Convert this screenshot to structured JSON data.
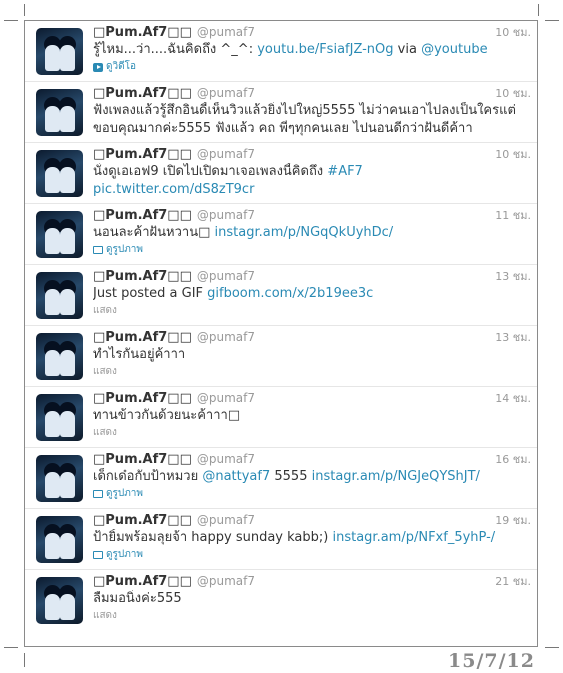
{
  "tweets": [
    {
      "name": "□Pum.Af7□□",
      "handle": "@pumaf7",
      "time": "10 ชม.",
      "lines": [
        [
          {
            "t": "รู้ไหม...ว่า....ฉันคิดถึง ^_^: "
          },
          {
            "t": "youtu.be/FsiafJZ-nOg",
            "link": true
          },
          {
            "t": " via "
          },
          {
            "t": "@youtube",
            "link": true
          }
        ]
      ],
      "meta": {
        "type": "video",
        "label": "ดูวิดีโอ"
      }
    },
    {
      "name": "□Pum.Af7□□",
      "handle": "@pumaf7",
      "time": "10 ชม.",
      "lines": [
        [
          {
            "t": "ฟังเพลงแล้วรู้สึกอินดี้เห็นวิวแล้วยิ่งไปใหญ่5555 ไม่ว่าคนเอาไปลงเป็นใครแต่"
          }
        ],
        [
          {
            "t": "ขอบคุณมากค่ะ5555 ฟังแล้ว คถ พี่ๆทุกคนเลย ไปนอนดีกว่าฝันดีค้าา"
          }
        ]
      ],
      "meta": null
    },
    {
      "name": "□Pum.Af7□□",
      "handle": "@pumaf7",
      "time": "10 ชม.",
      "lines": [
        [
          {
            "t": "นั่งดูเอเอฟ9 เปิดไปเปิดมาเจอเพลงนี้คิดถึง "
          },
          {
            "t": "#AF7",
            "link": true
          }
        ],
        [
          {
            "t": "pic.twitter.com/dS8zT9cr",
            "link": true
          }
        ]
      ],
      "meta": null
    },
    {
      "name": "□Pum.Af7□□",
      "handle": "@pumaf7",
      "time": "11 ชม.",
      "lines": [
        [
          {
            "t": "นอนละค้าฝันหวาน□ "
          },
          {
            "t": "instagr.am/p/NGqQkUyhDc/",
            "link": true
          }
        ]
      ],
      "meta": {
        "type": "photo",
        "label": "ดูรูปภาพ"
      }
    },
    {
      "name": "□Pum.Af7□□",
      "handle": "@pumaf7",
      "time": "13 ชม.",
      "lines": [
        [
          {
            "t": "Just posted a GIF "
          },
          {
            "t": "gifboom.com/x/2b19ee3c",
            "link": true
          }
        ]
      ],
      "meta": {
        "type": "plain",
        "label": "แสดง"
      }
    },
    {
      "name": "□Pum.Af7□□",
      "handle": "@pumaf7",
      "time": "13 ชม.",
      "lines": [
        [
          {
            "t": "ทำไรกันอยู่ค้าาา"
          }
        ]
      ],
      "meta": {
        "type": "plain",
        "label": "แสดง"
      }
    },
    {
      "name": "□Pum.Af7□□",
      "handle": "@pumaf7",
      "time": "14 ชม.",
      "lines": [
        [
          {
            "t": "ทานข้าวกันด้วยนะค้าาา□"
          }
        ]
      ],
      "meta": {
        "type": "plain",
        "label": "แสดง"
      }
    },
    {
      "name": "□Pum.Af7□□",
      "handle": "@pumaf7",
      "time": "16 ชม.",
      "lines": [
        [
          {
            "t": "เด็กเด๋อกับป้าหมวย "
          },
          {
            "t": "@nattyaf7",
            "link": true
          },
          {
            "t": " 5555 "
          },
          {
            "t": "instagr.am/p/NGJeQYShJT/",
            "link": true
          }
        ]
      ],
      "meta": {
        "type": "photo",
        "label": "ดูรูปภาพ"
      }
    },
    {
      "name": "□Pum.Af7□□",
      "handle": "@pumaf7",
      "time": "19 ชม.",
      "lines": [
        [
          {
            "t": "ป้ายิ้มพร้อมลุยจ้า happy sunday kabb;) "
          },
          {
            "t": "instagr.am/p/NFxf_5yhP-/",
            "link": true
          }
        ]
      ],
      "meta": {
        "type": "photo",
        "label": "ดูรูปภาพ"
      }
    },
    {
      "name": "□Pum.Af7□□",
      "handle": "@pumaf7",
      "time": "21 ชม.",
      "lines": [
        [
          {
            "t": "ลืมมอนิ่งค่ะ555"
          }
        ]
      ],
      "meta": {
        "type": "plain",
        "label": "แสดง"
      }
    }
  ],
  "date_stamp": "15/7/12",
  "colors": {
    "link": "#2a8ab4",
    "muted": "#999999",
    "text": "#333333",
    "border": "#8a8a8a"
  }
}
